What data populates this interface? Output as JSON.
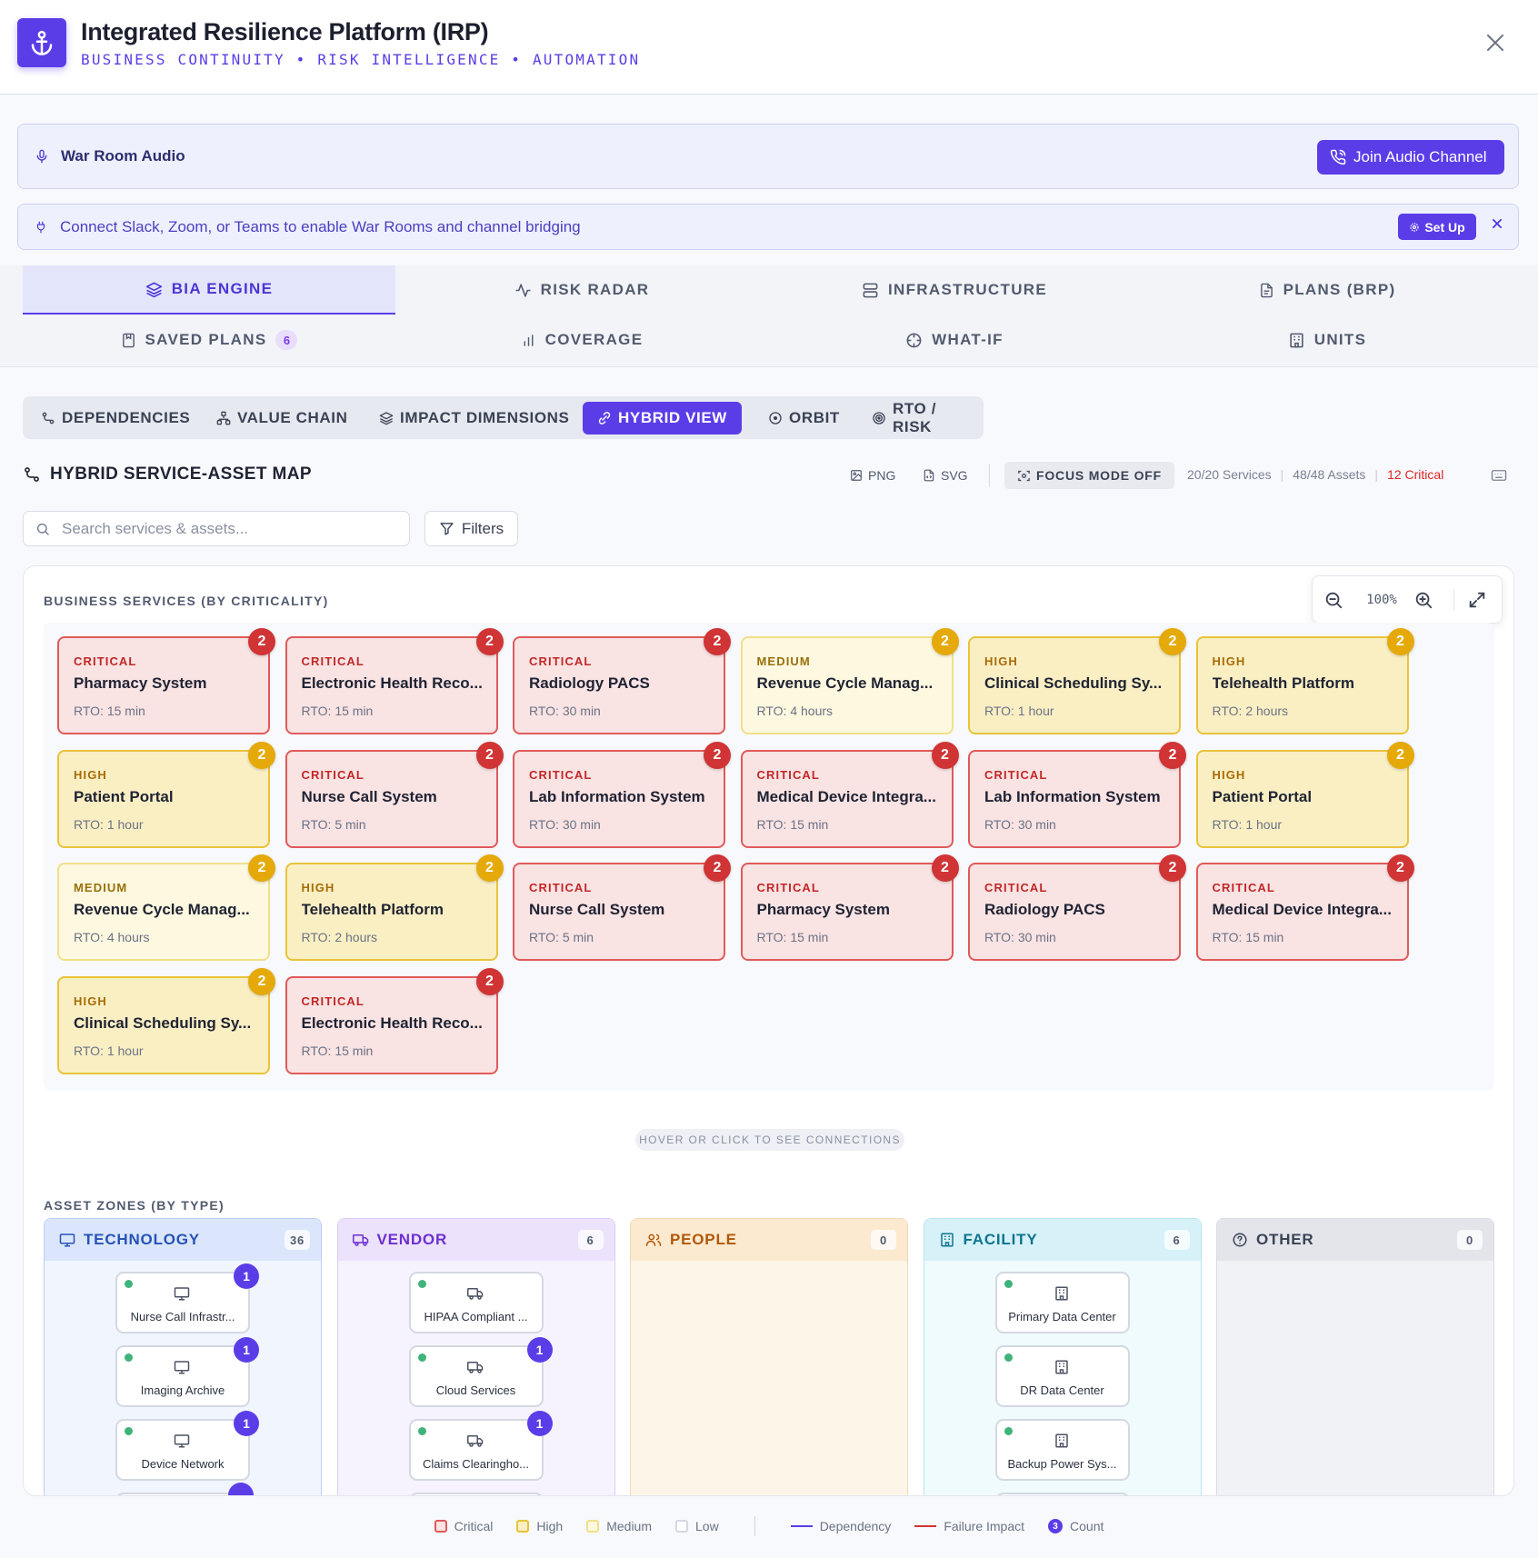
{
  "header": {
    "title": "Integrated Resilience Platform (IRP)",
    "subtitle": "BUSINESS CONTINUITY • RISK INTELLIGENCE • AUTOMATION"
  },
  "audio_banner": {
    "label": "War Room Audio",
    "button": "Join Audio Channel"
  },
  "connect_banner": {
    "text": "Connect Slack, Zoom, or Teams to enable War Rooms and channel bridging",
    "button": "Set Up"
  },
  "main_tabs": [
    {
      "label": "BIA ENGINE",
      "icon": "layers-icon",
      "active": true
    },
    {
      "label": "RISK RADAR",
      "icon": "activity-icon"
    },
    {
      "label": "INFRASTRUCTURE",
      "icon": "server-icon"
    },
    {
      "label": "PLANS (BRP)",
      "icon": "file-icon"
    },
    {
      "label": "SAVED PLANS",
      "icon": "bookmark-icon",
      "count": "6"
    },
    {
      "label": "COVERAGE",
      "icon": "bar-chart-icon"
    },
    {
      "label": "WHAT-IF",
      "icon": "crosshair-icon"
    },
    {
      "label": "UNITS",
      "icon": "building-icon"
    }
  ],
  "sub_tabs": [
    {
      "label": "DEPENDENCIES",
      "icon": "route-icon"
    },
    {
      "label": "VALUE CHAIN",
      "icon": "network-icon"
    },
    {
      "label": "IMPACT DIMENSIONS",
      "icon": "layers-icon"
    },
    {
      "label": "HYBRID VIEW",
      "icon": "link-icon",
      "active": true
    },
    {
      "label": "ORBIT",
      "icon": "orbit-icon"
    },
    {
      "label": "RTO / RISK",
      "icon": "target-icon"
    }
  ],
  "map": {
    "title": "HYBRID SERVICE-ASSET MAP",
    "png": "PNG",
    "svg": "SVG",
    "focus": "FOCUS MODE OFF",
    "services_stat": "20/20 Services",
    "assets_stat": "48/48 Assets",
    "critical_stat": "12 Critical",
    "search_placeholder": "Search services & assets...",
    "filters": "Filters",
    "zoom": "100%",
    "services_label": "BUSINESS SERVICES (BY CRITICALITY)",
    "hover_hint": "HOVER OR CLICK TO SEE CONNECTIONS",
    "assets_label": "ASSET ZONES (BY TYPE)"
  },
  "services": [
    {
      "level": "CRITICAL",
      "name": "Pharmacy System",
      "rto": "RTO: 15 min",
      "count": "2"
    },
    {
      "level": "CRITICAL",
      "name": "Electronic Health Reco...",
      "rto": "RTO: 15 min",
      "count": "2"
    },
    {
      "level": "CRITICAL",
      "name": "Radiology PACS",
      "rto": "RTO: 30 min",
      "count": "2"
    },
    {
      "level": "MEDIUM",
      "name": "Revenue Cycle Manag...",
      "rto": "RTO: 4 hours",
      "count": "2"
    },
    {
      "level": "HIGH",
      "name": "Clinical Scheduling Sy...",
      "rto": "RTO: 1 hour",
      "count": "2"
    },
    {
      "level": "HIGH",
      "name": "Telehealth Platform",
      "rto": "RTO: 2 hours",
      "count": "2"
    },
    {
      "level": "HIGH",
      "name": "Patient Portal",
      "rto": "RTO: 1 hour",
      "count": "2"
    },
    {
      "level": "CRITICAL",
      "name": "Nurse Call System",
      "rto": "RTO: 5 min",
      "count": "2"
    },
    {
      "level": "CRITICAL",
      "name": "Lab Information System",
      "rto": "RTO: 30 min",
      "count": "2"
    },
    {
      "level": "CRITICAL",
      "name": "Medical Device Integra...",
      "rto": "RTO: 15 min",
      "count": "2"
    },
    {
      "level": "CRITICAL",
      "name": "Lab Information System",
      "rto": "RTO: 30 min",
      "count": "2"
    },
    {
      "level": "HIGH",
      "name": "Patient Portal",
      "rto": "RTO: 1 hour",
      "count": "2"
    },
    {
      "level": "MEDIUM",
      "name": "Revenue Cycle Manag...",
      "rto": "RTO: 4 hours",
      "count": "2"
    },
    {
      "level": "HIGH",
      "name": "Telehealth Platform",
      "rto": "RTO: 2 hours",
      "count": "2"
    },
    {
      "level": "CRITICAL",
      "name": "Nurse Call System",
      "rto": "RTO: 5 min",
      "count": "2"
    },
    {
      "level": "CRITICAL",
      "name": "Pharmacy System",
      "rto": "RTO: 15 min",
      "count": "2"
    },
    {
      "level": "CRITICAL",
      "name": "Radiology PACS",
      "rto": "RTO: 30 min",
      "count": "2"
    },
    {
      "level": "CRITICAL",
      "name": "Medical Device Integra...",
      "rto": "RTO: 15 min",
      "count": "2"
    },
    {
      "level": "HIGH",
      "name": "Clinical Scheduling Sy...",
      "rto": "RTO: 1 hour",
      "count": "2"
    },
    {
      "level": "CRITICAL",
      "name": "Electronic Health Reco...",
      "rto": "RTO: 15 min",
      "count": "2"
    }
  ],
  "zones": [
    {
      "name": "TECHNOLOGY",
      "icon": "monitor-icon",
      "count": "36",
      "assets": [
        {
          "name": "Nurse Call Infrastr...",
          "count": "1"
        },
        {
          "name": "Imaging Archive",
          "count": "1"
        },
        {
          "name": "Device Network",
          "count": "1"
        }
      ]
    },
    {
      "name": "VENDOR",
      "icon": "truck-icon",
      "count": "6",
      "assets": [
        {
          "name": "HIPAA Compliant ..."
        },
        {
          "name": "Cloud Services",
          "count": "1"
        },
        {
          "name": "Claims Clearingho...",
          "count": "1"
        }
      ]
    },
    {
      "name": "PEOPLE",
      "icon": "users-icon",
      "count": "0",
      "assets": []
    },
    {
      "name": "FACILITY",
      "icon": "building-icon",
      "count": "6",
      "assets": [
        {
          "name": "Primary Data Center"
        },
        {
          "name": "DR Data Center"
        },
        {
          "name": "Backup Power Sys..."
        }
      ]
    },
    {
      "name": "OTHER",
      "icon": "help-circle-icon",
      "count": "0",
      "assets": []
    }
  ],
  "legend": {
    "critical": "Critical",
    "high": "High",
    "medium": "Medium",
    "low": "Low",
    "dependency": "Dependency",
    "failure": "Failure Impact",
    "count": "Count",
    "count_badge": "3"
  },
  "colors": {
    "accent": "#5b3de8",
    "critical": "#d03434",
    "high": "#e5a909",
    "success": "#3fb37a"
  }
}
